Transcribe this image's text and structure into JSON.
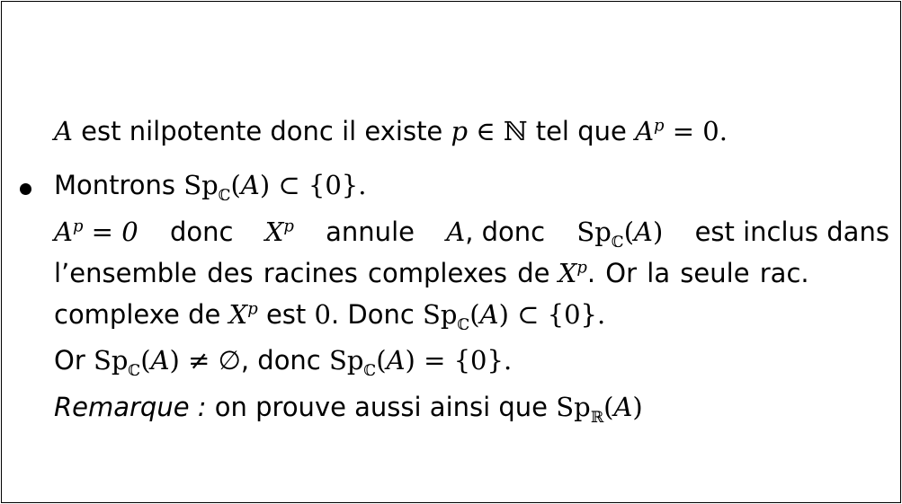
{
  "text": {
    "est_nilpotente": "est nilpotente donc il existe",
    "tel_que": "tel que",
    "montrons": "Montrons",
    "donc": "donc",
    "annule": "annule",
    "donc_sp": ", donc",
    "est_inclus": "est inclus dans",
    "ensemble": "l’ensemble des racines complexes de",
    "or_la_seule": ". Or la seule rac.",
    "complexe_de": "complexe de",
    "est": "est",
    "donc2": ". Donc",
    "or": "Or",
    "donc3": ", donc",
    "remarque": "Remarque :",
    "on_prouve": "on prouve aussi ainsi que"
  }
}
